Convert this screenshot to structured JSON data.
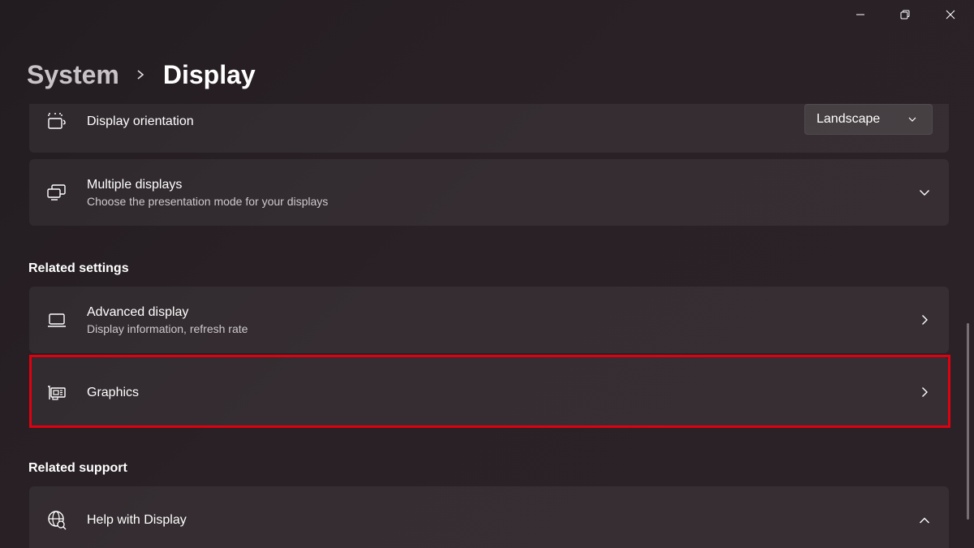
{
  "window_controls": {
    "minimize_icon": "minimize-icon",
    "restore_icon": "restore-icon",
    "close_icon": "close-icon"
  },
  "breadcrumb": {
    "parent": "System",
    "current": "Display"
  },
  "cards": {
    "orientation": {
      "title": "Display orientation",
      "icon": "display-orientation-icon",
      "dropdown_value": "Landscape"
    },
    "multiple_displays": {
      "title": "Multiple displays",
      "description": "Choose the presentation mode for your displays",
      "icon": "multiple-displays-icon"
    },
    "advanced_display": {
      "title": "Advanced display",
      "description": "Display information, refresh rate",
      "icon": "laptop-icon"
    },
    "graphics": {
      "title": "Graphics",
      "icon": "graphics-card-icon"
    },
    "help_display": {
      "title": "Help with Display",
      "icon": "globe-help-icon"
    }
  },
  "sections": {
    "related_settings": "Related settings",
    "related_support": "Related support"
  },
  "colors": {
    "highlight": "#e0000f",
    "background": "#261e23"
  }
}
